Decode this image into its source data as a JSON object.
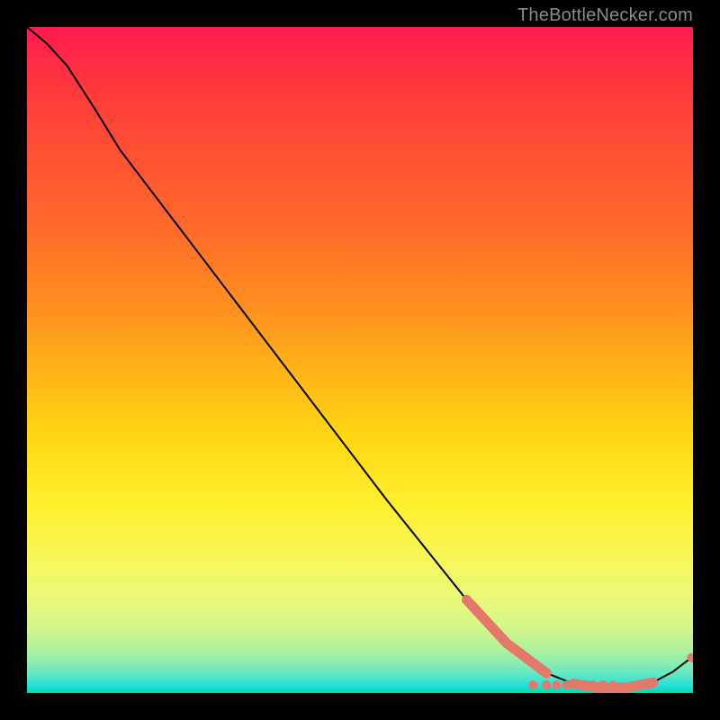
{
  "attribution": "TheBottleNecker.com",
  "chart_data": {
    "type": "line",
    "title": "",
    "xlabel": "",
    "ylabel": "",
    "xlim": [
      0,
      100
    ],
    "ylim": [
      0,
      100
    ],
    "series": [
      {
        "name": "curve",
        "points": [
          {
            "x": 0.0,
            "y": 100.0
          },
          {
            "x": 3.0,
            "y": 97.5
          },
          {
            "x": 6.0,
            "y": 94.2
          },
          {
            "x": 10.0,
            "y": 88.0
          },
          {
            "x": 14.0,
            "y": 81.5
          },
          {
            "x": 22.0,
            "y": 71.0
          },
          {
            "x": 38.0,
            "y": 50.0
          },
          {
            "x": 54.0,
            "y": 29.0
          },
          {
            "x": 66.0,
            "y": 14.0
          },
          {
            "x": 72.0,
            "y": 7.5
          },
          {
            "x": 78.0,
            "y": 3.0
          },
          {
            "x": 82.0,
            "y": 1.4
          },
          {
            "x": 86.0,
            "y": 0.8
          },
          {
            "x": 90.0,
            "y": 0.8
          },
          {
            "x": 94.0,
            "y": 1.6
          },
          {
            "x": 97.0,
            "y": 3.2
          },
          {
            "x": 100.0,
            "y": 5.5
          }
        ]
      }
    ],
    "highlight_segments": [
      {
        "from": 8,
        "to": 10
      },
      {
        "from": 11,
        "to": 14
      }
    ],
    "highlight_dots": [
      {
        "x": 76.0,
        "y": 1.2
      },
      {
        "x": 78.0,
        "y": 1.2
      },
      {
        "x": 79.5,
        "y": 1.2
      },
      {
        "x": 81.0,
        "y": 1.2
      },
      {
        "x": 83.0,
        "y": 1.2
      },
      {
        "x": 85.0,
        "y": 1.2
      },
      {
        "x": 86.5,
        "y": 1.2
      },
      {
        "x": 88.0,
        "y": 1.2
      },
      {
        "x": 93.5,
        "y": 1.3
      },
      {
        "x": 99.8,
        "y": 5.3
      }
    ],
    "colors": {
      "curve": "#000000",
      "highlight": "#e4786b"
    }
  }
}
